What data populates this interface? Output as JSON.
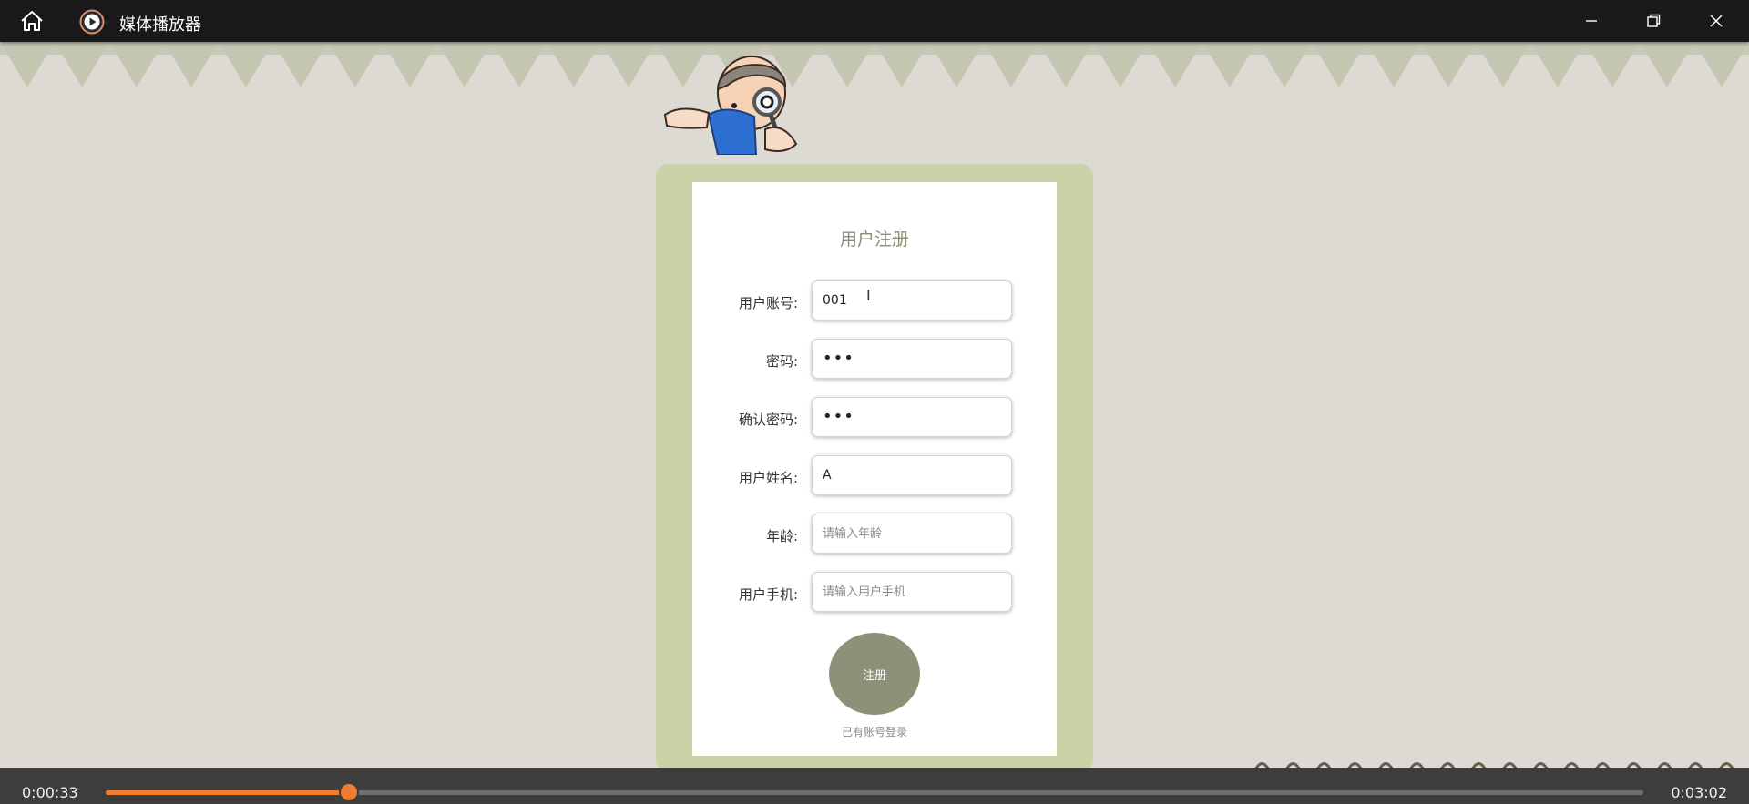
{
  "window": {
    "title": "媒体播放器",
    "icons": {
      "home": "home-icon",
      "app": "play-circle-icon",
      "minimize": "minimize-icon",
      "maximize": "restore-icon",
      "close": "close-icon"
    }
  },
  "form": {
    "title": "用户注册",
    "fields": [
      {
        "label": "用户账号:",
        "value": "001",
        "placeholder": ""
      },
      {
        "label": "密码:",
        "value": "•••",
        "placeholder": ""
      },
      {
        "label": "确认密码:",
        "value": "•••",
        "placeholder": ""
      },
      {
        "label": "用户姓名:",
        "value": "A",
        "placeholder": ""
      },
      {
        "label": "年龄:",
        "value": "",
        "placeholder": "请输入年龄"
      },
      {
        "label": "用户手机:",
        "value": "",
        "placeholder": "请输入用户手机"
      }
    ],
    "submit_label": "注册",
    "login_link": "已有账号登录"
  },
  "player": {
    "current_time": "0:00:33",
    "total_time": "0:03:02",
    "progress": 0.158,
    "colors": {
      "accent": "#f07d2f"
    }
  },
  "colors": {
    "card_frame": "#c9d1a6",
    "button": "#8d9177",
    "title_bar": "#191919"
  }
}
